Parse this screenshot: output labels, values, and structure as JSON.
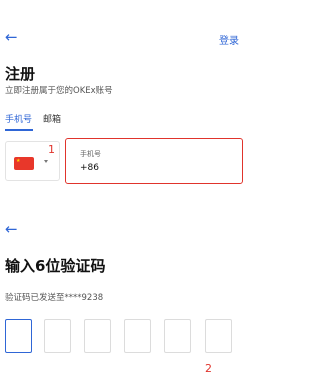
{
  "header": {
    "back_icon": "arrow-left-icon",
    "login_label": "登录"
  },
  "register": {
    "title": "注册",
    "subtitle": "立即注册属于您的OKEx账号",
    "tabs": [
      {
        "label": "手机号",
        "active": true
      },
      {
        "label": "邮箱",
        "active": false
      }
    ],
    "country": {
      "flag": "china-flag-icon"
    },
    "phone": {
      "label": "手机号",
      "value": "+86"
    }
  },
  "annotations": {
    "one": "1",
    "two": "2"
  },
  "verify": {
    "back_icon": "arrow-left-icon",
    "title": "输入6位验证码",
    "sent_text": "验证码已发送至****9238",
    "code_boxes": 6
  },
  "colors": {
    "accent": "#2f66d6",
    "annotation": "#e0342c"
  }
}
